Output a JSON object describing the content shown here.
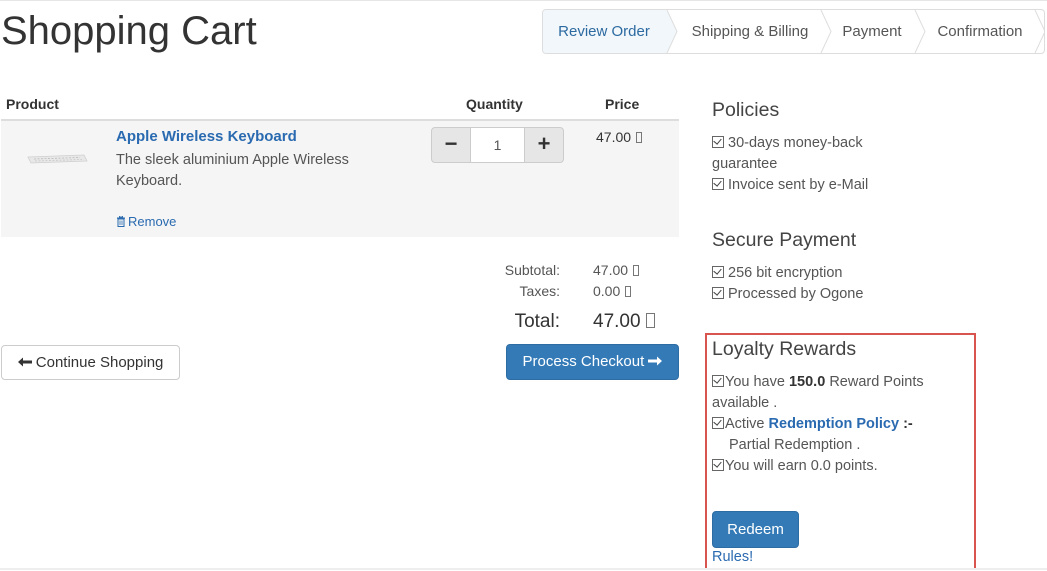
{
  "page": {
    "title": "Shopping Cart"
  },
  "wizard": {
    "steps": [
      {
        "label": "Review Order",
        "active": true
      },
      {
        "label": "Shipping & Billing",
        "active": false
      },
      {
        "label": "Payment",
        "active": false
      },
      {
        "label": "Confirmation",
        "active": false
      }
    ]
  },
  "cart": {
    "headers": {
      "product": "Product",
      "quantity": "Quantity",
      "price": "Price"
    },
    "items": [
      {
        "name": "Apple Wireless Keyboard",
        "description": "The sleek aluminium Apple Wireless Keyboard.",
        "remove_label": "Remove",
        "quantity": "1",
        "price": "47.00"
      }
    ],
    "minus_symbol": "−",
    "plus_symbol": "+"
  },
  "totals": {
    "subtotal_label": "Subtotal:",
    "subtotal_value": "47.00",
    "taxes_label": "Taxes:",
    "taxes_value": "0.00",
    "total_label": "Total:",
    "total_value": "47.00"
  },
  "actions": {
    "continue_label": "Continue Shopping",
    "checkout_label": "Process Checkout"
  },
  "sidebar": {
    "policies": {
      "title": "Policies",
      "items": [
        "30-days money-back guarantee",
        "Invoice sent by e-Mail"
      ]
    },
    "secure_payment": {
      "title": "Secure Payment",
      "items": [
        "256 bit encryption",
        "Processed by Ogone"
      ]
    },
    "loyalty": {
      "title": "Loyalty Rewards",
      "points_prefix": "You have",
      "points_value": "150.0",
      "points_suffix": "Reward Points",
      "points_suffix_2": "available .",
      "active_prefix": "Active",
      "policy_link": "Redemption Policy",
      "policy_sep": ":-",
      "policy_value": "Partial Redemption .",
      "earn_text": "You will earn 0.0 points.",
      "redeem_label": "Redeem",
      "rules_label": "Rules!"
    }
  },
  "colors": {
    "link": "#2a6ab0",
    "primary_button": "#337ab7",
    "highlight_border": "#d9534f",
    "active_step_bg": "#f2f7fb"
  }
}
